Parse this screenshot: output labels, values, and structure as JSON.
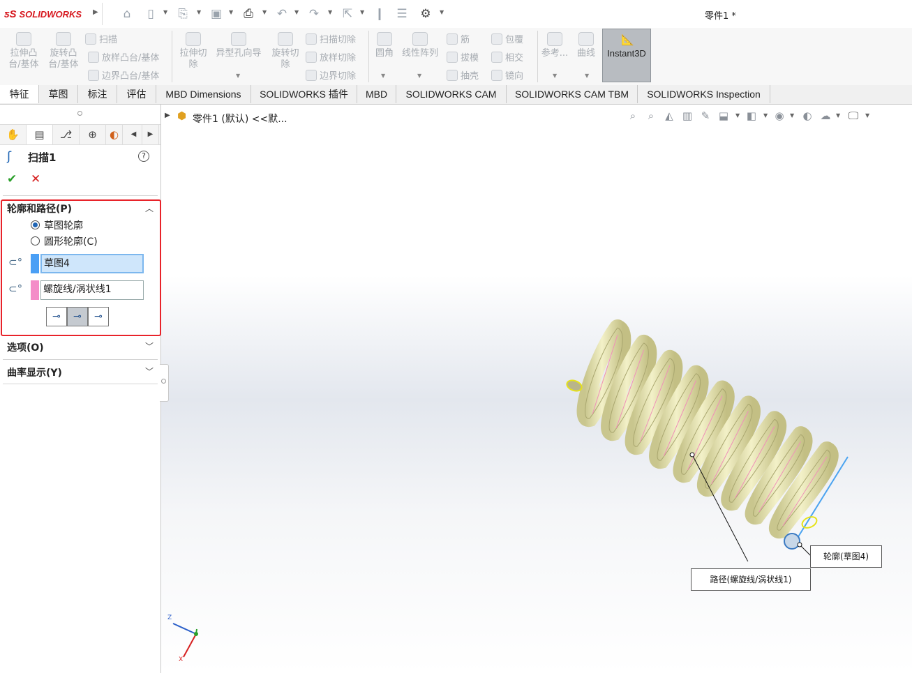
{
  "app": {
    "brand": "SOLIDWORKS",
    "document_title": "零件1 *"
  },
  "title_toolbar": {
    "icons": [
      "home-icon",
      "new-icon",
      "open-icon",
      "save-icon",
      "print-icon",
      "undo-icon",
      "redo-icon",
      "select-icon",
      "rebuild-icon",
      "file-properties-icon",
      "options-icon"
    ]
  },
  "ribbon": {
    "extrude_boss": "拉伸凸\n台/基体",
    "revolve_boss": "旋转凸\n台/基体",
    "sweep": "扫描",
    "loft_boss": "放样凸台/基体",
    "boundary_boss": "边界凸台/基体",
    "extrude_cut": "拉伸切\n除",
    "hole_wizard": "异型孔向导",
    "revolve_cut": "旋转切\n除",
    "sweep_cut": "扫描切除",
    "loft_cut": "放样切除",
    "boundary_cut": "边界切除",
    "fillet": "圆角",
    "linear_pattern": "线性阵列",
    "rib": "筋",
    "draft": "拔模",
    "shell": "抽壳",
    "wrap": "包覆",
    "intersect": "相交",
    "mirror": "镜向",
    "reference": "参考...",
    "curves": "曲线",
    "instant3d": "Instant3D"
  },
  "tabs": [
    "特征",
    "草图",
    "标注",
    "评估",
    "MBD Dimensions",
    "SOLIDWORKS 插件",
    "MBD",
    "SOLIDWORKS CAM",
    "SOLIDWORKS CAM TBM",
    "SOLIDWORKS Inspection"
  ],
  "active_tab": "特征",
  "property_manager": {
    "feature_title": "扫描1",
    "section_profile_path": "轮廓和路径(P)",
    "radio_sketch_profile": "草图轮廓",
    "radio_circular_profile": "圆形轮廓(C)",
    "selected_radio": "草图轮廓",
    "profile_value": "草图4",
    "path_value": "螺旋线/涡状线1",
    "profile_color": "#4a9ff5",
    "path_color": "#f48cc8",
    "section_options": "选项(O)",
    "section_curvature": "曲率显示(Y)"
  },
  "viewport": {
    "tree_label": "零件1 (默认) <<默...",
    "callout_profile": "轮廓(草图4)",
    "callout_path": "路径(螺旋线/涡状线1)",
    "triad": {
      "z": "Z",
      "x": "X",
      "y": "Y"
    }
  },
  "colors": {
    "accent": "#1e64b4",
    "highlight_box": "#e8232a",
    "spring": "#ece9b6"
  }
}
